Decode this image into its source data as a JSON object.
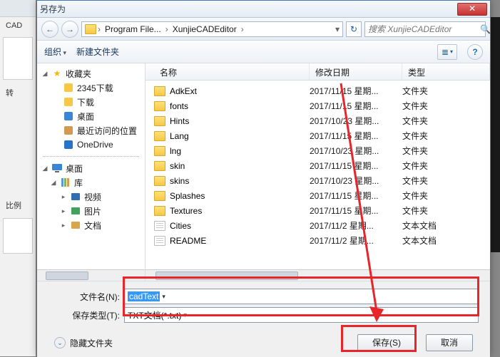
{
  "bg": {
    "cad": "CAD",
    "zhuan": "转",
    "bili": "比例"
  },
  "title": "另存为",
  "close_glyph": "✕",
  "nav": {
    "back": "←",
    "fwd": "→",
    "up": "▾",
    "refresh": "↻"
  },
  "breadcrumb": {
    "icon": "folder-icon",
    "p1": "Program File...",
    "p2": "XunjieCADEditor",
    "sep": "›",
    "tail": "›"
  },
  "search": {
    "placeholder": "搜索 XunjieCADEditor",
    "icon": "🔍"
  },
  "toolbar": {
    "organize": "组织",
    "newfolder": "新建文件夹",
    "view_icon": "≣",
    "help": "?"
  },
  "sidebar": {
    "fav_header": "收藏夹",
    "items_fav": [
      {
        "icon": "download-icon",
        "label": "2345下载",
        "color": "#f7c845"
      },
      {
        "icon": "download-icon",
        "label": "下载",
        "color": "#f7c845"
      },
      {
        "icon": "desktop-icon",
        "label": "桌面",
        "color": "#3a85d6"
      },
      {
        "icon": "recent-icon",
        "label": "最近访问的位置",
        "color": "#d49a52"
      },
      {
        "icon": "onedrive-icon",
        "label": "OneDrive",
        "color": "#2674c8"
      }
    ],
    "desktop_header": "桌面",
    "lib_header": "库",
    "items_lib": [
      {
        "icon": "video-icon",
        "label": "视频",
        "color": "#2f6fb0"
      },
      {
        "icon": "picture-icon",
        "label": "图片",
        "color": "#41a25d"
      },
      {
        "icon": "doc-icon",
        "label": "文档",
        "color": "#d8a64a"
      }
    ]
  },
  "columns": {
    "name": "名称",
    "date": "修改日期",
    "type": "类型"
  },
  "files": [
    {
      "kind": "folder",
      "name": "AdkExt",
      "date": "2017/11/15 星期...",
      "type": "文件夹"
    },
    {
      "kind": "folder",
      "name": "fonts",
      "date": "2017/11/15 星期...",
      "type": "文件夹"
    },
    {
      "kind": "folder",
      "name": "Hints",
      "date": "2017/10/23 星期...",
      "type": "文件夹"
    },
    {
      "kind": "folder",
      "name": "Lang",
      "date": "2017/11/15 星期...",
      "type": "文件夹"
    },
    {
      "kind": "folder",
      "name": "lng",
      "date": "2017/10/23 星期...",
      "type": "文件夹"
    },
    {
      "kind": "folder",
      "name": "skin",
      "date": "2017/11/15 星期...",
      "type": "文件夹"
    },
    {
      "kind": "folder",
      "name": "skins",
      "date": "2017/10/23 星期...",
      "type": "文件夹"
    },
    {
      "kind": "folder",
      "name": "Splashes",
      "date": "2017/11/15 星期...",
      "type": "文件夹"
    },
    {
      "kind": "folder",
      "name": "Textures",
      "date": "2017/11/15 星期...",
      "type": "文件夹"
    },
    {
      "kind": "file",
      "name": "Cities",
      "date": "2017/11/2 星期...",
      "type": "文本文档"
    },
    {
      "kind": "file",
      "name": "README",
      "date": "2017/11/2 星期...",
      "type": "文本文档"
    }
  ],
  "form": {
    "filename_label": "文件名(N):",
    "filename_value": "cadText",
    "filetype_label": "保存类型(T):",
    "filetype_value": "TXT文档(*.txt)"
  },
  "footer": {
    "hide_folders": "隐藏文件夹",
    "save": "保存(S)",
    "cancel": "取消"
  }
}
